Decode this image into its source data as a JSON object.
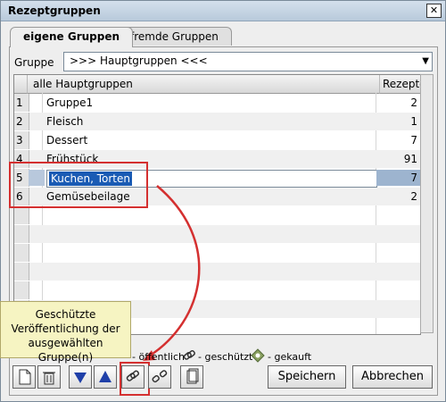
{
  "window": {
    "title": "Rezeptgruppen",
    "close": "✕"
  },
  "tabs": [
    {
      "label": "eigene Gruppen"
    },
    {
      "label": "fremde Gruppen"
    }
  ],
  "filter": {
    "label": "Gruppe",
    "value": ">>> Hauptgruppen <<<"
  },
  "table": {
    "headers": [
      "alle Hauptgruppen",
      "Rezepte"
    ],
    "rows": [
      {
        "num": "1",
        "name": "Gruppe1",
        "count": "2"
      },
      {
        "num": "2",
        "name": "Fleisch",
        "count": "1"
      },
      {
        "num": "3",
        "name": "Dessert",
        "count": "7"
      },
      {
        "num": "4",
        "name": "Frühstück",
        "count": "91"
      },
      {
        "num": "5",
        "name": "Kuchen, Torten",
        "count": "7"
      },
      {
        "num": "6",
        "name": "Gemüsebeilage",
        "count": "2"
      }
    ]
  },
  "tooltip": {
    "text": "Geschützte Veröffentlichung der ausgewählten Gruppe(n)"
  },
  "legend": {
    "public": "- öffentlich",
    "protected": "- geschützt",
    "bought": "- gekauft"
  },
  "buttons": {
    "save": "Speichern",
    "cancel": "Abbrechen"
  },
  "colors": {
    "selection": "#1a5bb4",
    "annotation": "#d43030",
    "tooltip_bg": "#f6f4c2"
  }
}
